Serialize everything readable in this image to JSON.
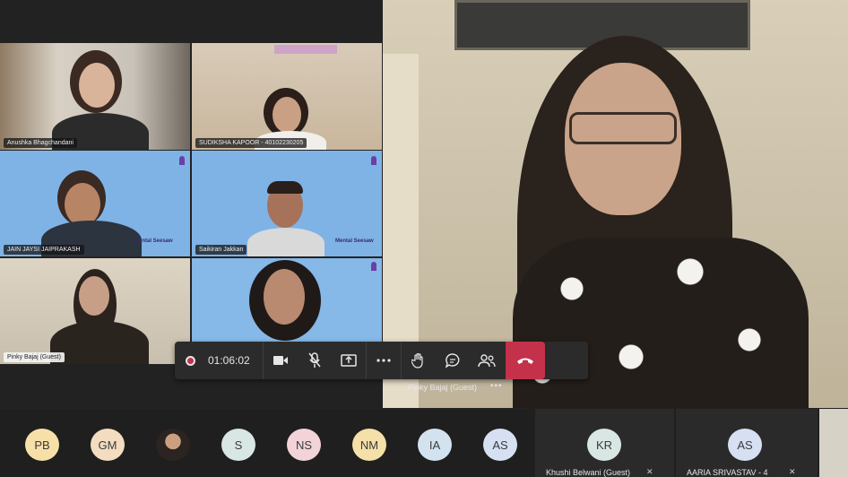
{
  "call": {
    "timer": "01:06:02",
    "featured_name": "Pinky Bajaj (Guest)",
    "featured_more": "•••"
  },
  "tiles": [
    {
      "name": "Anushka Bhagchandani"
    },
    {
      "name": "SUDIKSHA KAPOOR - 40102230205"
    },
    {
      "name": "JAIN JAYSI JAIPRAKASH"
    },
    {
      "name": "Saikiran Jakkan"
    },
    {
      "name": "Pinky Bajaj (Guest)"
    },
    {
      "name": ""
    }
  ],
  "branding": {
    "label": "Mental Seesaw"
  },
  "controls": {
    "camera_icon": "camera-icon",
    "mic_icon": "mic-off-icon",
    "share_icon": "share-screen-icon",
    "more_icon": "more-icon",
    "hand_icon": "raise-hand-icon",
    "chat_icon": "chat-icon",
    "people_icon": "participants-icon",
    "hangup_icon": "hang-up-icon"
  },
  "roster": {
    "avatars": [
      {
        "initials": "PB",
        "color": "#f7e0a8"
      },
      {
        "initials": "GM",
        "color": "#f3dcc0"
      },
      {
        "initials": "",
        "color": "#caa07e"
      },
      {
        "initials": "S",
        "color": "#d8e6e4"
      },
      {
        "initials": "NS",
        "color": "#f2d3d8"
      },
      {
        "initials": "NM",
        "color": "#f4e0a8"
      },
      {
        "initials": "IA",
        "color": "#d2e2ef"
      },
      {
        "initials": "AS",
        "color": "#d6e0f2"
      }
    ],
    "cards": [
      {
        "initials": "KR",
        "color": "#d8e6e4",
        "name": "Khushi Belwani (Guest)"
      },
      {
        "initials": "AS",
        "color": "#d6e0f2",
        "name": "AARIA SRIVASTAV - 4"
      }
    ]
  },
  "colors": {
    "hangup": "#c4314b",
    "tile_blue": "#7fb3e6"
  }
}
